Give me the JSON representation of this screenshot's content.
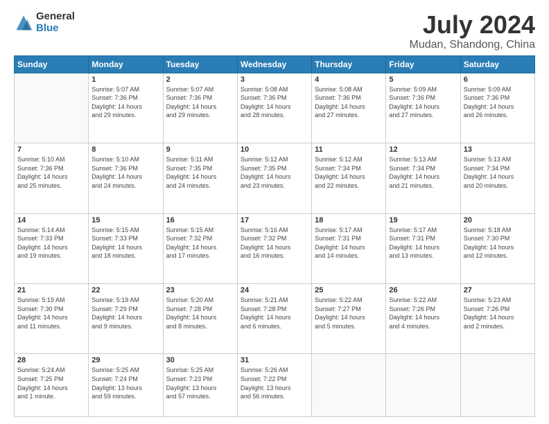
{
  "logo": {
    "general": "General",
    "blue": "Blue"
  },
  "title": "July 2024",
  "subtitle": "Mudan, Shandong, China",
  "header_days": [
    "Sunday",
    "Monday",
    "Tuesday",
    "Wednesday",
    "Thursday",
    "Friday",
    "Saturday"
  ],
  "weeks": [
    [
      {
        "day": "",
        "info": ""
      },
      {
        "day": "1",
        "info": "Sunrise: 5:07 AM\nSunset: 7:36 PM\nDaylight: 14 hours\nand 29 minutes."
      },
      {
        "day": "2",
        "info": "Sunrise: 5:07 AM\nSunset: 7:36 PM\nDaylight: 14 hours\nand 29 minutes."
      },
      {
        "day": "3",
        "info": "Sunrise: 5:08 AM\nSunset: 7:36 PM\nDaylight: 14 hours\nand 28 minutes."
      },
      {
        "day": "4",
        "info": "Sunrise: 5:08 AM\nSunset: 7:36 PM\nDaylight: 14 hours\nand 27 minutes."
      },
      {
        "day": "5",
        "info": "Sunrise: 5:09 AM\nSunset: 7:36 PM\nDaylight: 14 hours\nand 27 minutes."
      },
      {
        "day": "6",
        "info": "Sunrise: 5:09 AM\nSunset: 7:36 PM\nDaylight: 14 hours\nand 26 minutes."
      }
    ],
    [
      {
        "day": "7",
        "info": "Sunrise: 5:10 AM\nSunset: 7:36 PM\nDaylight: 14 hours\nand 25 minutes."
      },
      {
        "day": "8",
        "info": "Sunrise: 5:10 AM\nSunset: 7:36 PM\nDaylight: 14 hours\nand 24 minutes."
      },
      {
        "day": "9",
        "info": "Sunrise: 5:11 AM\nSunset: 7:35 PM\nDaylight: 14 hours\nand 24 minutes."
      },
      {
        "day": "10",
        "info": "Sunrise: 5:12 AM\nSunset: 7:35 PM\nDaylight: 14 hours\nand 23 minutes."
      },
      {
        "day": "11",
        "info": "Sunrise: 5:12 AM\nSunset: 7:34 PM\nDaylight: 14 hours\nand 22 minutes."
      },
      {
        "day": "12",
        "info": "Sunrise: 5:13 AM\nSunset: 7:34 PM\nDaylight: 14 hours\nand 21 minutes."
      },
      {
        "day": "13",
        "info": "Sunrise: 5:13 AM\nSunset: 7:34 PM\nDaylight: 14 hours\nand 20 minutes."
      }
    ],
    [
      {
        "day": "14",
        "info": "Sunrise: 5:14 AM\nSunset: 7:33 PM\nDaylight: 14 hours\nand 19 minutes."
      },
      {
        "day": "15",
        "info": "Sunrise: 5:15 AM\nSunset: 7:33 PM\nDaylight: 14 hours\nand 18 minutes."
      },
      {
        "day": "16",
        "info": "Sunrise: 5:15 AM\nSunset: 7:32 PM\nDaylight: 14 hours\nand 17 minutes."
      },
      {
        "day": "17",
        "info": "Sunrise: 5:16 AM\nSunset: 7:32 PM\nDaylight: 14 hours\nand 16 minutes."
      },
      {
        "day": "18",
        "info": "Sunrise: 5:17 AM\nSunset: 7:31 PM\nDaylight: 14 hours\nand 14 minutes."
      },
      {
        "day": "19",
        "info": "Sunrise: 5:17 AM\nSunset: 7:31 PM\nDaylight: 14 hours\nand 13 minutes."
      },
      {
        "day": "20",
        "info": "Sunrise: 5:18 AM\nSunset: 7:30 PM\nDaylight: 14 hours\nand 12 minutes."
      }
    ],
    [
      {
        "day": "21",
        "info": "Sunrise: 5:19 AM\nSunset: 7:30 PM\nDaylight: 14 hours\nand 11 minutes."
      },
      {
        "day": "22",
        "info": "Sunrise: 5:19 AM\nSunset: 7:29 PM\nDaylight: 14 hours\nand 9 minutes."
      },
      {
        "day": "23",
        "info": "Sunrise: 5:20 AM\nSunset: 7:28 PM\nDaylight: 14 hours\nand 8 minutes."
      },
      {
        "day": "24",
        "info": "Sunrise: 5:21 AM\nSunset: 7:28 PM\nDaylight: 14 hours\nand 6 minutes."
      },
      {
        "day": "25",
        "info": "Sunrise: 5:22 AM\nSunset: 7:27 PM\nDaylight: 14 hours\nand 5 minutes."
      },
      {
        "day": "26",
        "info": "Sunrise: 5:22 AM\nSunset: 7:26 PM\nDaylight: 14 hours\nand 4 minutes."
      },
      {
        "day": "27",
        "info": "Sunrise: 5:23 AM\nSunset: 7:26 PM\nDaylight: 14 hours\nand 2 minutes."
      }
    ],
    [
      {
        "day": "28",
        "info": "Sunrise: 5:24 AM\nSunset: 7:25 PM\nDaylight: 14 hours\nand 1 minute."
      },
      {
        "day": "29",
        "info": "Sunrise: 5:25 AM\nSunset: 7:24 PM\nDaylight: 13 hours\nand 59 minutes."
      },
      {
        "day": "30",
        "info": "Sunrise: 5:25 AM\nSunset: 7:23 PM\nDaylight: 13 hours\nand 57 minutes."
      },
      {
        "day": "31",
        "info": "Sunrise: 5:26 AM\nSunset: 7:22 PM\nDaylight: 13 hours\nand 56 minutes."
      },
      {
        "day": "",
        "info": ""
      },
      {
        "day": "",
        "info": ""
      },
      {
        "day": "",
        "info": ""
      }
    ]
  ]
}
